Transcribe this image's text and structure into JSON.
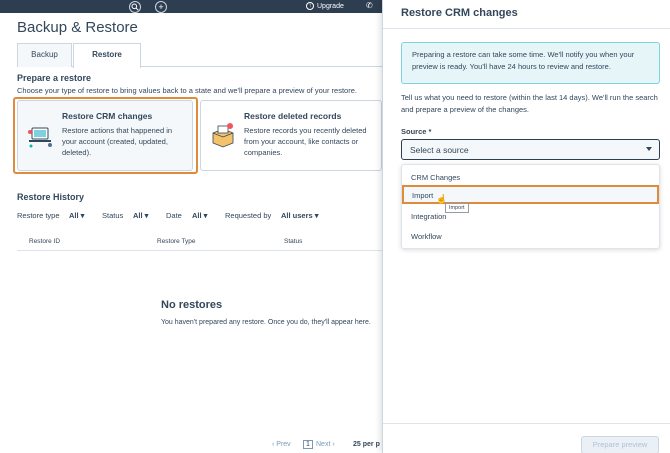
{
  "nav": {
    "search_icon": "search-icon",
    "add_icon": "plus-icon",
    "upgrade_label": "Upgrade",
    "phone_icon": "phone-icon"
  },
  "page": {
    "title": "Backup & Restore",
    "tabs": [
      {
        "label": "Backup"
      },
      {
        "label": "Restore"
      }
    ],
    "prepare": {
      "title": "Prepare a restore",
      "description": "Choose your type of restore to bring values back to a state and we'll prepare a preview of your restore.",
      "cards": [
        {
          "title": "Restore CRM changes",
          "description": "Restore actions that happened in your account (created, updated, deleted)."
        },
        {
          "title": "Restore deleted records",
          "description": "Restore records you recently deleted from your account, like contacts or companies."
        }
      ]
    },
    "history": {
      "title": "Restore History",
      "filters": [
        {
          "label": "Restore type",
          "value": "All"
        },
        {
          "label": "Status",
          "value": "All"
        },
        {
          "label": "Date",
          "value": "All"
        },
        {
          "label": "Requested by",
          "value": "All users"
        }
      ],
      "columns": [
        "Restore ID",
        "Restore Type",
        "Status"
      ],
      "empty_title": "No restores",
      "empty_description": "You haven't prepared any restore. Once you do, they'll appear here."
    },
    "pager": {
      "prev": "Prev",
      "page": "1",
      "next": "Next",
      "per_page": "25 per p"
    }
  },
  "panel": {
    "title": "Restore CRM changes",
    "alert": "Preparing a restore can take some time. We'll notify you when your preview is ready. You'll have 24 hours to review and restore.",
    "description": "Tell us what you need to restore (within the last 14 days). We'll run the search and prepare a preview of the changes.",
    "source_label": "Source *",
    "select_placeholder": "Select a source",
    "options": [
      "CRM Changes",
      "Import",
      "Integration",
      "Workflow"
    ],
    "tooltip": "Import",
    "preview_button": "Prepare preview"
  },
  "colors": {
    "nav_bg": "#2d3e50",
    "highlight": "#e08b3c",
    "alert_bg": "#e5f5f8"
  }
}
